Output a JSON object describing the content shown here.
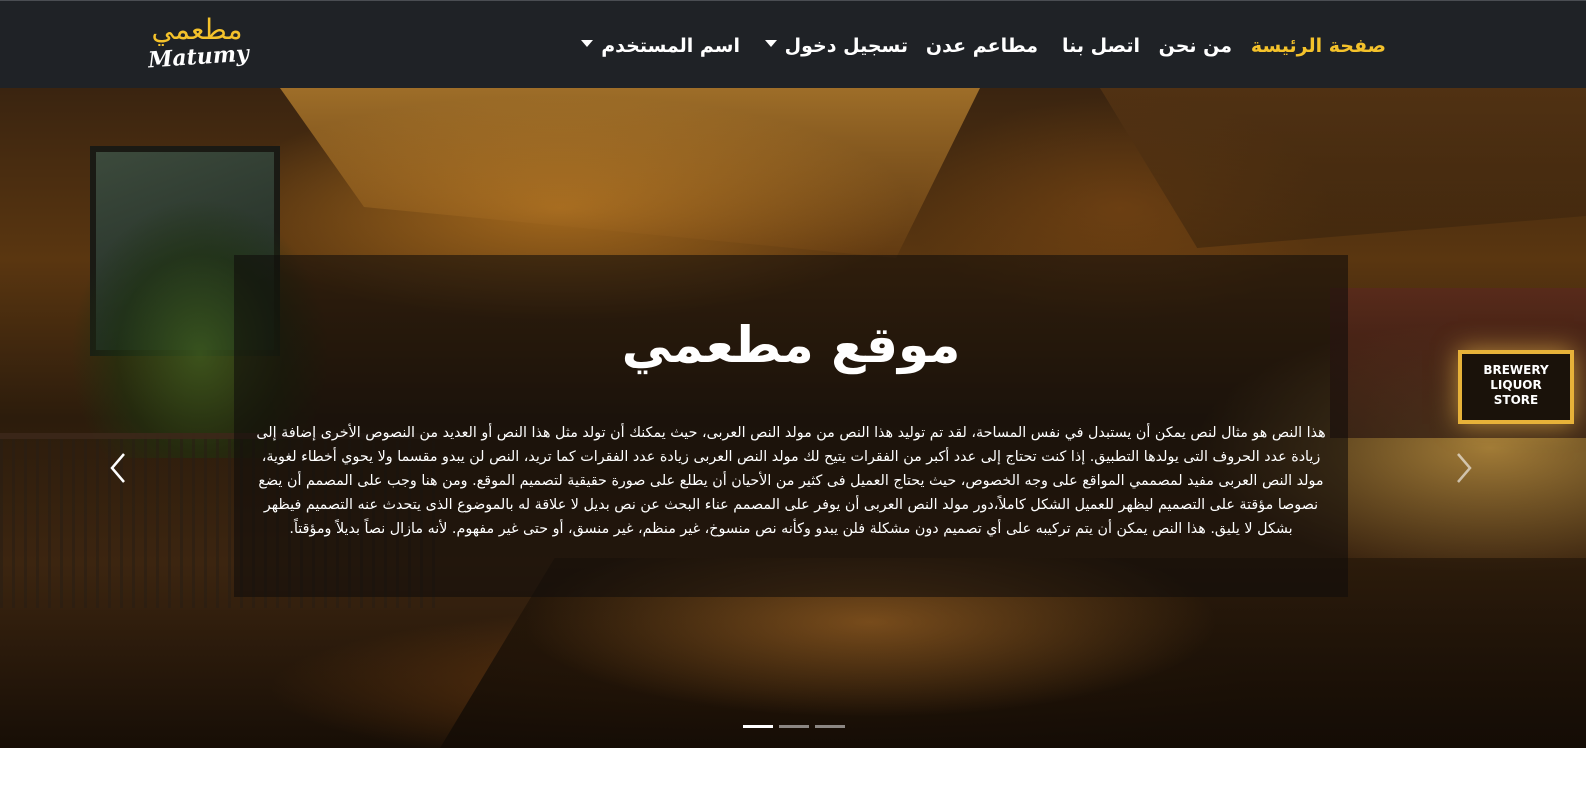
{
  "brand": {
    "arabic": "مطعمي",
    "latin": "Matumy",
    "accent_color": "#f4c22b"
  },
  "nav": {
    "home": "صفحة الرئيسة",
    "about": "من نحن",
    "contact": "اتصل بنا",
    "aden_restaurants": "مطاعم عدن",
    "login": "تسجيل دخول",
    "username": "اسم المستخدم",
    "dropdown_icon": "caret-down-icon"
  },
  "hero": {
    "title": "موقع مطعمي",
    "paragraph": "هذا النص هو مثال لنص يمكن أن يستبدل في نفس المساحة، لقد تم توليد هذا النص من مولد النص العربى، حيث يمكنك أن تولد مثل هذا النص أو العديد من النصوص الأخرى إضافة إلى زيادة عدد الحروف التى يولدها التطبيق. إذا كنت تحتاج إلى عدد أكبر من الفقرات يتيح لك مولد النص العربى زيادة عدد الفقرات كما تريد، النص لن يبدو مقسما ولا يحوي أخطاء لغوية، مولد النص العربى مفيد لمصممي المواقع على وجه الخصوص، حيث يحتاج العميل فى كثير من الأحيان أن يطلع على صورة حقيقية لتصميم الموقع. ومن هنا وجب على المصمم أن يضع نصوصا مؤقتة على التصميم ليظهر للعميل الشكل كاملاً،دور مولد النص العربى أن يوفر على المصمم عناء البحث عن نص بديل لا علاقة له بالموضوع الذى يتحدث عنه التصميم فيظهر بشكل لا يليق. هذا النص يمكن أن يتم تركيبه على أي تصميم دون مشكلة فلن يبدو وكأنه نص منسوخ، غير منظم، غير منسق، أو حتى غير مفهوم. لأنه مازال نصاً بديلاً ومؤقتاً.",
    "store_sign": "BREWERY\nLIQUOR\nSTORE",
    "prev_icon": "chevron-left-icon",
    "next_icon": "chevron-right-icon",
    "slides_count": 3,
    "active_slide": 1
  }
}
